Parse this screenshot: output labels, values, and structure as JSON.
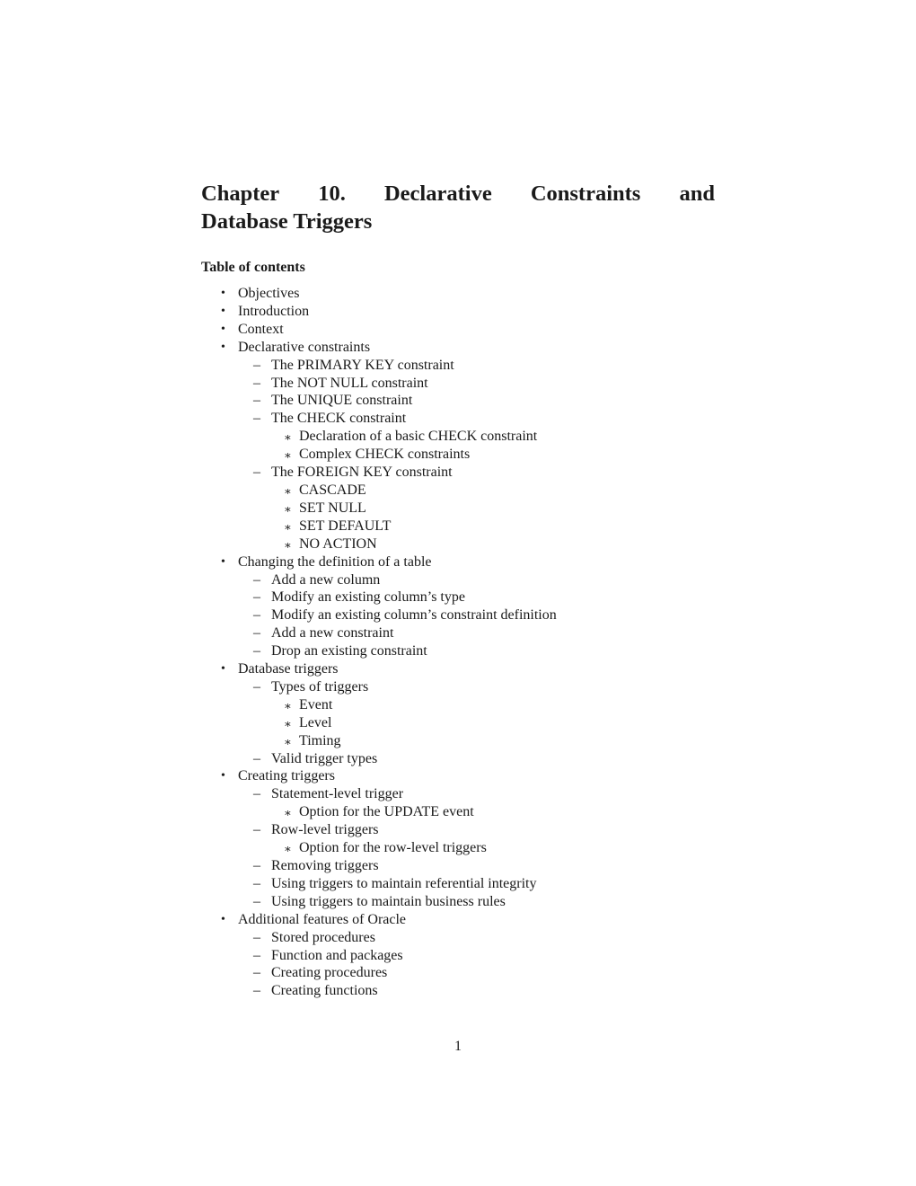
{
  "chapter": {
    "title_line1_words": [
      "Chapter",
      "10.",
      "Declarative",
      "Constraints",
      "and"
    ],
    "title_line2": "Database Triggers"
  },
  "toc": {
    "heading": "Table of contents",
    "markers": {
      "level1": "•",
      "level2": "–",
      "level3": "∗"
    },
    "items": [
      {
        "level": 1,
        "label": "Objectives"
      },
      {
        "level": 1,
        "label": "Introduction"
      },
      {
        "level": 1,
        "label": "Context"
      },
      {
        "level": 1,
        "label": "Declarative constraints"
      },
      {
        "level": 2,
        "label": "The PRIMARY KEY constraint"
      },
      {
        "level": 2,
        "label": "The NOT NULL constraint"
      },
      {
        "level": 2,
        "label": "The UNIQUE constraint"
      },
      {
        "level": 2,
        "label": "The CHECK constraint"
      },
      {
        "level": 3,
        "label": "Declaration of a basic CHECK constraint"
      },
      {
        "level": 3,
        "label": "Complex CHECK constraints"
      },
      {
        "level": 2,
        "label": "The FOREIGN KEY constraint"
      },
      {
        "level": 3,
        "label": "CASCADE"
      },
      {
        "level": 3,
        "label": "SET NULL"
      },
      {
        "level": 3,
        "label": "SET DEFAULT"
      },
      {
        "level": 3,
        "label": "NO ACTION"
      },
      {
        "level": 1,
        "label": "Changing the definition of a table"
      },
      {
        "level": 2,
        "label": "Add a new column"
      },
      {
        "level": 2,
        "label": "Modify an existing column’s type"
      },
      {
        "level": 2,
        "label": "Modify an existing column’s constraint definition"
      },
      {
        "level": 2,
        "label": "Add a new constraint"
      },
      {
        "level": 2,
        "label": "Drop an existing constraint"
      },
      {
        "level": 1,
        "label": "Database triggers"
      },
      {
        "level": 2,
        "label": "Types of triggers"
      },
      {
        "level": 3,
        "label": "Event"
      },
      {
        "level": 3,
        "label": "Level"
      },
      {
        "level": 3,
        "label": "Timing"
      },
      {
        "level": 2,
        "label": "Valid trigger types"
      },
      {
        "level": 1,
        "label": "Creating triggers"
      },
      {
        "level": 2,
        "label": "Statement-level trigger"
      },
      {
        "level": 3,
        "label": "Option for the UPDATE event"
      },
      {
        "level": 2,
        "label": "Row-level triggers"
      },
      {
        "level": 3,
        "label": "Option for the row-level triggers"
      },
      {
        "level": 2,
        "label": "Removing triggers"
      },
      {
        "level": 2,
        "label": "Using triggers to maintain referential integrity"
      },
      {
        "level": 2,
        "label": "Using triggers to maintain business rules"
      },
      {
        "level": 1,
        "label": "Additional features of Oracle"
      },
      {
        "level": 2,
        "label": "Stored procedures"
      },
      {
        "level": 2,
        "label": "Function and packages"
      },
      {
        "level": 2,
        "label": "Creating procedures"
      },
      {
        "level": 2,
        "label": "Creating functions"
      }
    ]
  },
  "footer": {
    "page_number": "1"
  }
}
